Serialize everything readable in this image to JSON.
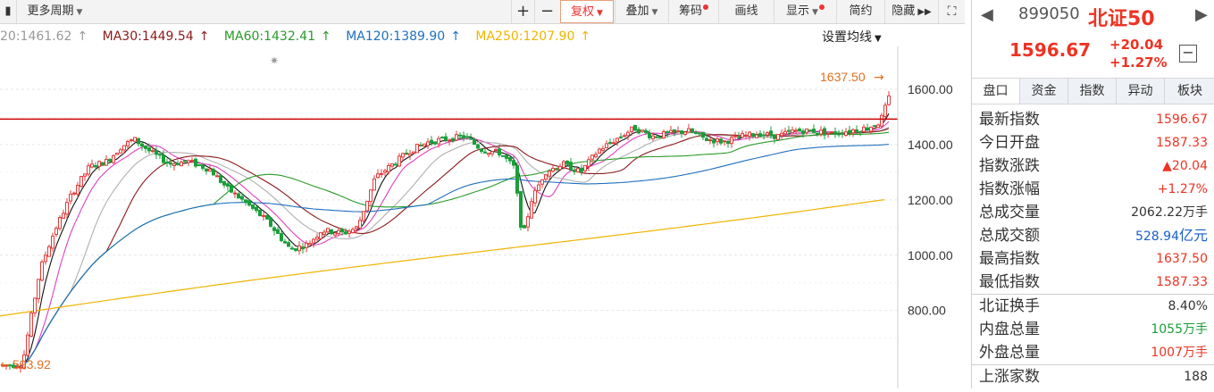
{
  "toolbar": {
    "more_period": "更多周期",
    "plus": "+",
    "minus": "−",
    "fuquan": "复权",
    "overlay": "叠加",
    "chips": "筹码",
    "draw": "画线",
    "display": "显示",
    "simple": "简约",
    "hide": "隐藏"
  },
  "ma": {
    "ma20": "20:1461.62",
    "ma30": "MA30:1449.54",
    "ma60": "MA60:1432.41",
    "ma120": "MA120:1389.90",
    "ma250": "MA250:1207.90",
    "arrow": "↑",
    "set_ma": "设置均线"
  },
  "chart": {
    "high_label": "1637.50",
    "low_label": "593.92",
    "y_ticks": [
      "1600.00",
      "1400.00",
      "1200.00",
      "1000.00",
      "800.00"
    ],
    "colors": {
      "up": "#e33b3b",
      "down": "#1a9e3a",
      "ma5": "#111111",
      "ma10": "#e040c0",
      "ma20": "#b0b0b0",
      "ma30": "#8b1a1a",
      "ma60": "#2a9a2a",
      "ma120": "#1f6fbf",
      "ma250": "#f0b400",
      "resist": "#cc0000"
    }
  },
  "quote": {
    "code": "899050",
    "name": "北证50",
    "price": "1596.67",
    "change": "+20.04",
    "change_pct": "+1.27%",
    "minus_btn": "−",
    "tabs": [
      "盘口",
      "资金",
      "指数",
      "异动",
      "板块"
    ],
    "rows": [
      {
        "label": "最新指数",
        "value": "1596.67"
      },
      {
        "label": "今日开盘",
        "value": "1587.33"
      },
      {
        "label": "指数涨跌",
        "value": "▲20.04"
      },
      {
        "label": "指数涨幅",
        "value": "+1.27%"
      },
      {
        "label": "总成交量",
        "value": "2062.22万手"
      },
      {
        "label": "总成交额",
        "num": "528.94",
        "unit": "亿元"
      },
      {
        "label": "最高指数",
        "value": "1637.50"
      },
      {
        "label": "最低指数",
        "value": "1587.33"
      },
      {
        "label": "北证换手",
        "value": "8.40%"
      },
      {
        "label": "内盘总量",
        "value": "1055万手"
      },
      {
        "label": "外盘总量",
        "value": "1007万手"
      },
      {
        "label": "上涨家数",
        "value": "188"
      }
    ]
  }
}
